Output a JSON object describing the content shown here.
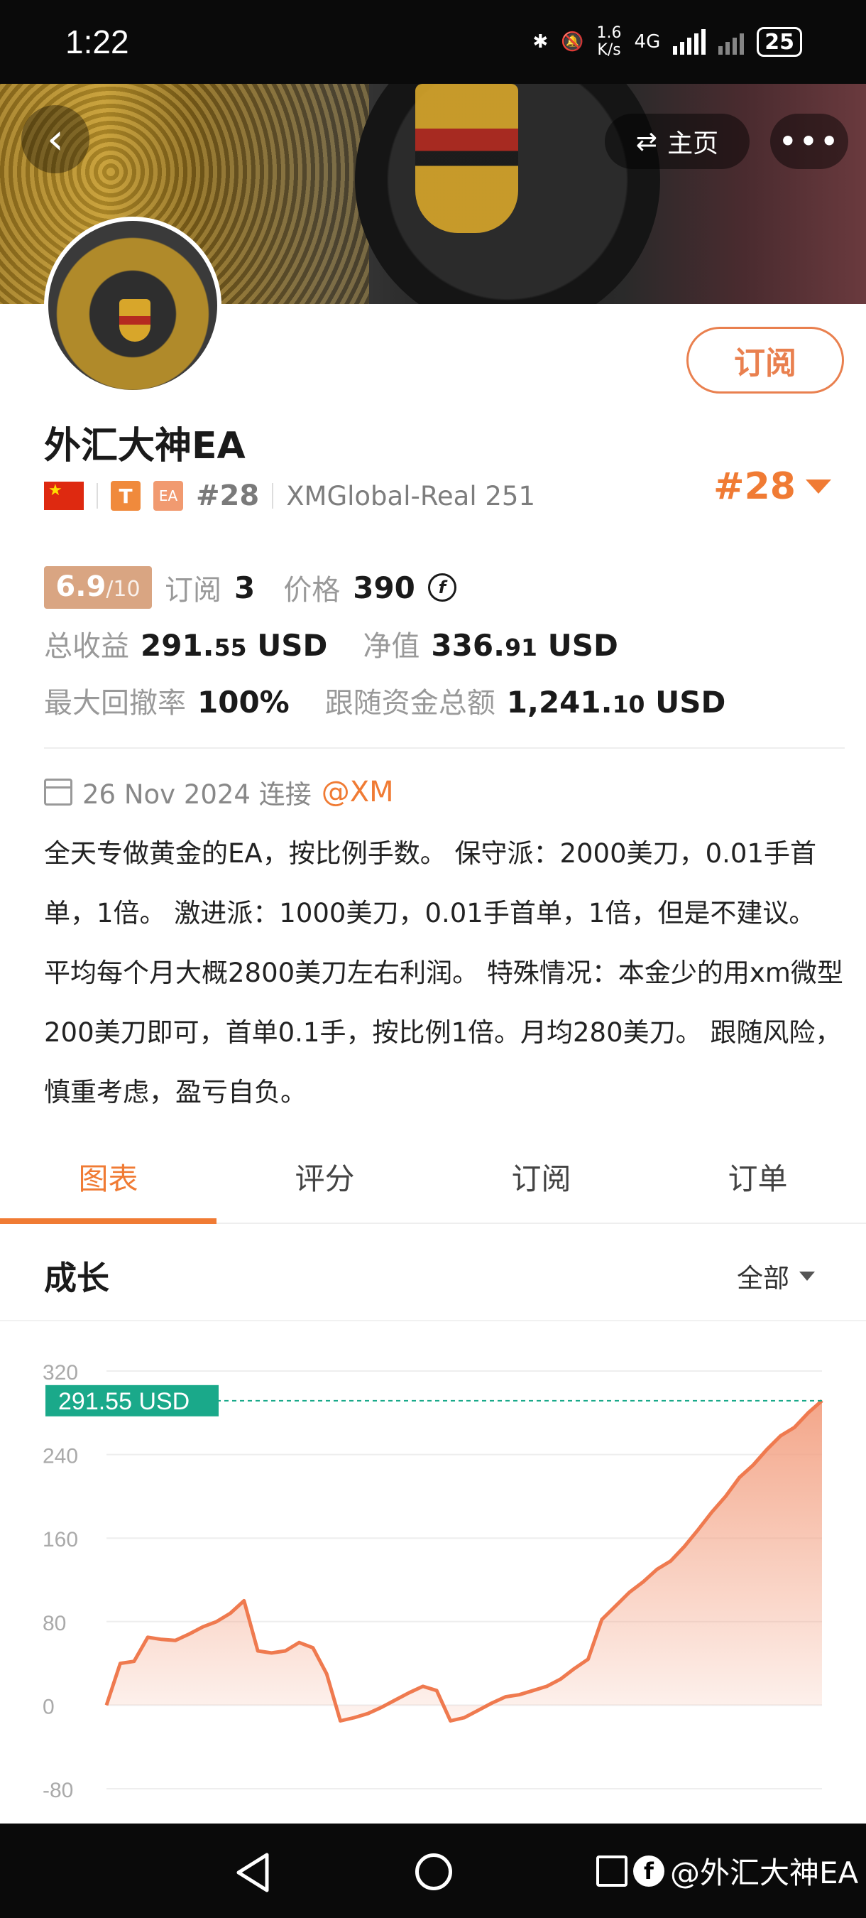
{
  "status_bar": {
    "time": "1:22",
    "net_speed_value": "1.6",
    "net_speed_unit": "K/s",
    "network": "4G",
    "battery": "25"
  },
  "header": {
    "home_label": "主页",
    "more_label": "•••",
    "back_icon": "chevron-left-icon"
  },
  "profile": {
    "subscribe_label": "订阅",
    "name": "外汇大神EA",
    "flag": "china-flag",
    "badge_t": "T",
    "badge_ea": "EA",
    "rank_small": "#28",
    "account": "XMGlobal-Real 251",
    "rank_big": "#28"
  },
  "stats": {
    "score": "6.9",
    "score_total": "/10",
    "subscriptions_label": "订阅",
    "subscriptions": "3",
    "price_label": "价格",
    "price": "390",
    "total_profit_label": "总收益",
    "total_profit_main": "291.",
    "total_profit_dec": "55",
    "total_profit_unit": "USD",
    "equity_label": "净值",
    "equity_main": "336.",
    "equity_dec": "91",
    "equity_unit": "USD",
    "max_drawdown_label": "最大回撤率",
    "max_drawdown": "100%",
    "follow_funds_label": "跟随资金总额",
    "follow_funds_main": "1,241.",
    "follow_funds_dec": "10",
    "follow_funds_unit": "USD"
  },
  "connect": {
    "date": "26 Nov 2024 连接",
    "broker": "@XM"
  },
  "description": "全天专做黄金的EA，按比例手数。 保守派：2000美刀，0.01手首单，1倍。 激进派：1000美刀，0.01手首单，1倍，但是不建议。 平均每个月大概2800美刀左右利润。 特殊情况：本金少的用xm微型200美刀即可，首单0.1手，按比例1倍。月均280美刀。 跟随风险，慎重考虑，盈亏自负。",
  "tabs": [
    {
      "label": "图表",
      "active": true
    },
    {
      "label": "评分",
      "active": false
    },
    {
      "label": "订阅",
      "active": false
    },
    {
      "label": "订单",
      "active": false
    }
  ],
  "growth_section": {
    "title": "成长",
    "filter_label": "全部"
  },
  "chart_data": {
    "type": "area",
    "title": "",
    "ylim": [
      -80,
      320
    ],
    "yticks": [
      "320",
      "240",
      "160",
      "80",
      "0",
      "-80"
    ],
    "current_label": "291.55 USD",
    "current_value": 291.55,
    "colors": {
      "line": "#ef7a4f",
      "fill_top": "#f3a284",
      "label_bg": "#1aa98a",
      "dash": "#1aa98a"
    },
    "values": [
      0,
      40,
      42,
      65,
      63,
      62,
      68,
      75,
      80,
      88,
      100,
      52,
      50,
      52,
      60,
      55,
      30,
      -15,
      -12,
      -8,
      -2,
      5,
      12,
      18,
      14,
      -15,
      -12,
      -5,
      2,
      8,
      10,
      14,
      18,
      25,
      35,
      44,
      82,
      95,
      108,
      118,
      130,
      138,
      152,
      168,
      185,
      200,
      218,
      230,
      245,
      258,
      266,
      280,
      291.55
    ]
  },
  "nav_bar": {
    "watermark": "@外汇大神EA"
  }
}
